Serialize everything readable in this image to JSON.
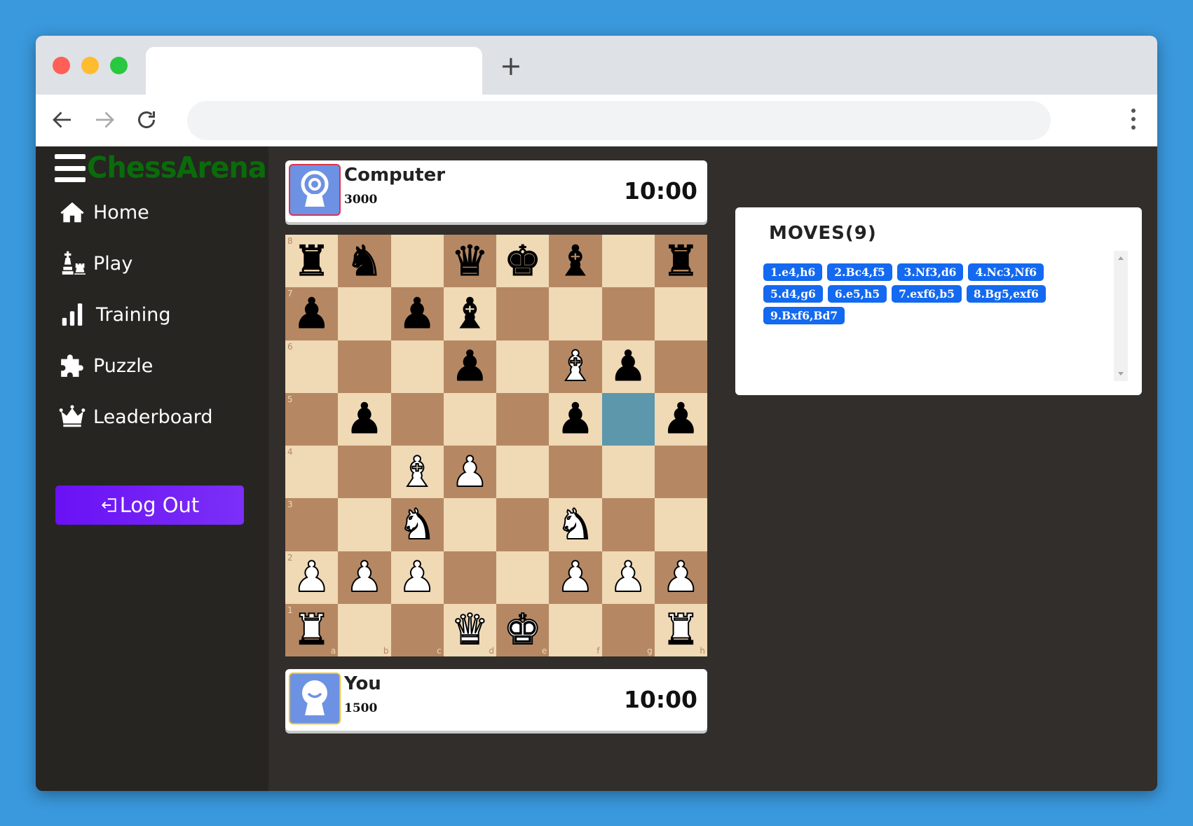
{
  "browser": {
    "new_tab_glyph": "+"
  },
  "brand": {
    "name": "ChessArena"
  },
  "sidebar": {
    "items": [
      {
        "label": "Home",
        "icon": "home-icon"
      },
      {
        "label": "Play",
        "icon": "chess-pieces-icon"
      },
      {
        "label": "Training",
        "icon": "bar-chart-icon"
      },
      {
        "label": "Puzzle",
        "icon": "puzzle-icon"
      },
      {
        "label": "Leaderboard",
        "icon": "crown-icon"
      }
    ],
    "logout_label": "Log Out"
  },
  "opponent": {
    "name": "Computer",
    "rating": "3000",
    "clock": "10:00"
  },
  "player": {
    "name": "You",
    "rating": "1500",
    "clock": "10:00"
  },
  "board": {
    "rows": [
      [
        "br",
        "bn",
        "",
        "bq",
        "bk",
        "bb",
        "",
        "br"
      ],
      [
        "bp",
        "",
        "bp",
        "bb",
        "",
        "",
        "",
        ""
      ],
      [
        "",
        "",
        "",
        "bp",
        "",
        "wb",
        "bp",
        ""
      ],
      [
        "",
        "bp",
        "",
        "",
        "",
        "bp",
        "",
        "bp"
      ],
      [
        "",
        "",
        "wb",
        "wp",
        "",
        "",
        "",
        ""
      ],
      [
        "",
        "",
        "wn",
        "",
        "",
        "wn",
        "",
        ""
      ],
      [
        "wp",
        "wp",
        "wp",
        "",
        "",
        "wp",
        "wp",
        "wp"
      ],
      [
        "wr",
        "",
        "",
        "wq",
        "wk",
        "",
        "",
        "wr"
      ]
    ],
    "highlight": "g5",
    "ranks": [
      "8",
      "7",
      "6",
      "5",
      "4",
      "3",
      "2",
      "1"
    ],
    "files": [
      "a",
      "b",
      "c",
      "d",
      "e",
      "f",
      "g",
      "h"
    ]
  },
  "moves": {
    "title": "MOVES(9)",
    "list": [
      "1.e4,h6",
      "2.Bc4,f5",
      "3.Nf3,d6",
      "4.Nc3,Nf6",
      "5.d4,g6",
      "6.e5,h5",
      "7.exf6,b5",
      "8.Bg5,exf6",
      "9.Bxf6,Bd7"
    ]
  },
  "colors": {
    "accent": "#1369f0",
    "logout": "#6a11f5",
    "brand": "#0a6b0a",
    "board_light": "#f0d9b5",
    "board_dark": "#b58863",
    "highlight": "#5c97ab"
  }
}
